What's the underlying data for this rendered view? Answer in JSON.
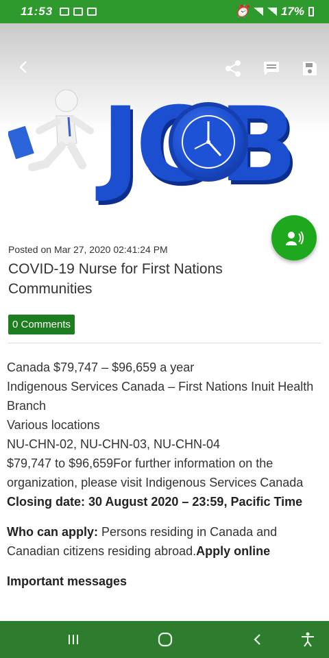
{
  "status_bar": {
    "time": "11:53",
    "battery": "17%"
  },
  "header": {
    "back_icon": "chevron-left-icon",
    "share_icon": "share-icon",
    "comment_icon": "comment-icon",
    "save_icon": "save-icon"
  },
  "hero": {
    "word": "JOB"
  },
  "post": {
    "posted": "Posted on Mar 27, 2020 02:41:24 PM",
    "title": "COVID-19 Nurse for First Nations Communities",
    "comments": "0 Comments"
  },
  "content": {
    "line1": "Canada $79,747 – $96,659 a year",
    "line2": "Indigenous Services Canada – First Nations Inuit Health Branch",
    "line3": "Various locations",
    "line4": "NU-CHN-02, NU-CHN-03, NU-CHN-04",
    "line5": "$79,747 to $96,659For further information on the organization, please visit Indigenous Services Canada ",
    "closing": "Closing date: 30 August 2020 – 23:59, Pacific Time",
    "who_label": "Who can apply:",
    "who_text": " Persons residing in Canada and Canadian citizens residing abroad.",
    "apply": "Apply online",
    "important": "Important messages"
  },
  "colors": {
    "status_green": "#2e9a2e",
    "nav_green": "#2e7d2e",
    "fab_green": "#1ea81e",
    "badge_green": "#1e7d1e",
    "job_blue": "#1c4fd0"
  }
}
